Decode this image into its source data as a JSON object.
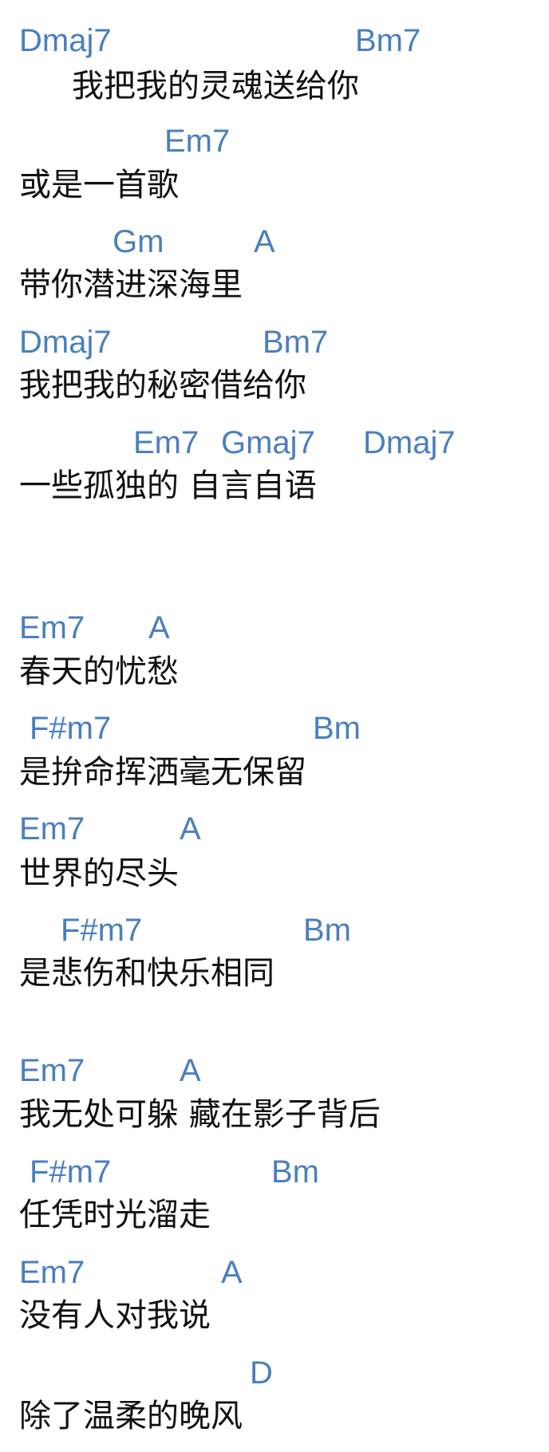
{
  "lines": [
    {
      "chords": [
        "Dmaj7",
        "Bm7"
      ],
      "lyric": "我把我的灵魂送给你"
    },
    {
      "chords": [
        "Em7"
      ],
      "lyric": "或是一首歌"
    },
    {
      "chords": [
        "Gm",
        "A"
      ],
      "lyric": "带你潜进深海里"
    },
    {
      "chords": [
        "Dmaj7",
        "Bm7"
      ],
      "lyric": "我把我的秘密借给你"
    },
    {
      "chords": [
        "Em7",
        "Gmaj7",
        "Dmaj7"
      ],
      "lyric": "一些孤独的 自言自语"
    },
    {
      "chords": [
        "Em7",
        "A"
      ],
      "lyric": "春天的忧愁"
    },
    {
      "chords": [
        "F#m7",
        "Bm"
      ],
      "lyric": "是拚命挥洒毫无保留"
    },
    {
      "chords": [
        "Em7",
        "A"
      ],
      "lyric": "世界的尽头"
    },
    {
      "chords": [
        "F#m7",
        "Bm"
      ],
      "lyric": "是悲伤和快乐相同"
    },
    {
      "chords": [
        "Em7",
        "A"
      ],
      "lyric": "我无处可躲 藏在影子背后"
    },
    {
      "chords": [
        "F#m7",
        "Bm"
      ],
      "lyric": "任凭时光溜走"
    },
    {
      "chords": [
        "Em7",
        "A"
      ],
      "lyric": "没有人对我说"
    },
    {
      "chords": [
        "D"
      ],
      "lyric": "除了温柔的晚风"
    }
  ]
}
